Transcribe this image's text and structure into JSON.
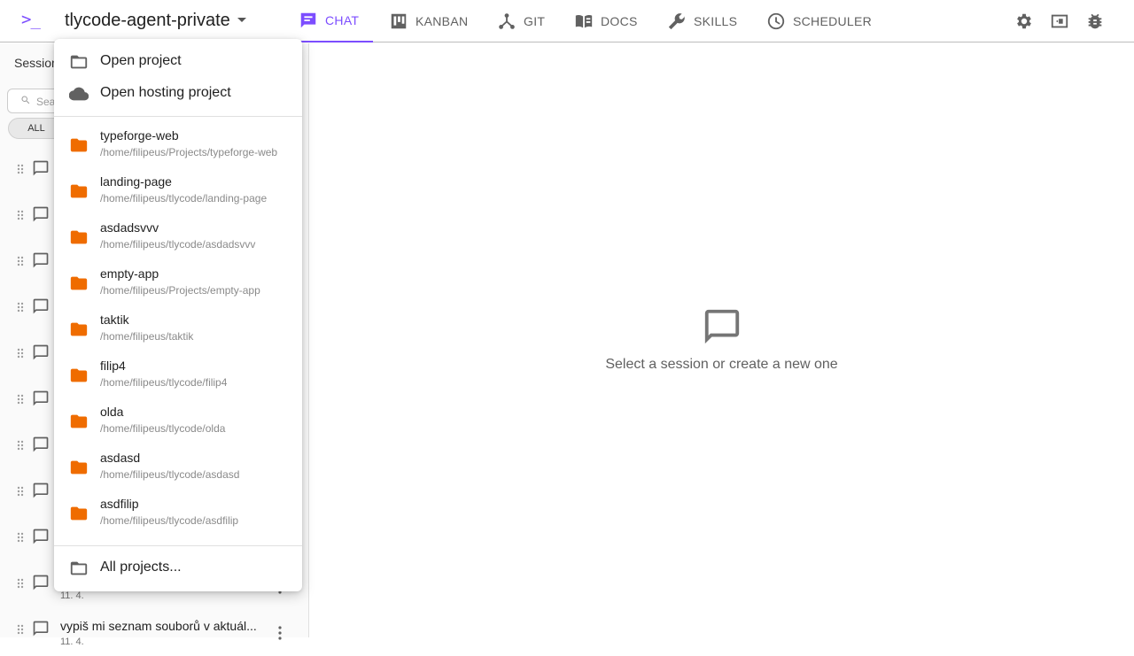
{
  "header": {
    "logo": ">_",
    "project_title": "tlycode-agent-private",
    "tabs": [
      {
        "label": "CHAT",
        "icon": "chat-icon"
      },
      {
        "label": "KANBAN",
        "icon": "kanban-icon"
      },
      {
        "label": "GIT",
        "icon": "git-icon"
      },
      {
        "label": "DOCS",
        "icon": "docs-icon"
      },
      {
        "label": "SKILLS",
        "icon": "wrench-icon"
      },
      {
        "label": "SCHEDULER",
        "icon": "clock-icon"
      }
    ],
    "active_tab": "CHAT",
    "right_icons": [
      "gear-icon",
      "panel-toggle-icon",
      "bug-icon"
    ]
  },
  "sidebar": {
    "title": "Session",
    "search_placeholder": "Sea",
    "filter_chip": "ALL",
    "sessions": [
      {
        "title": "",
        "date": ""
      },
      {
        "title": "",
        "date": ""
      },
      {
        "title": "",
        "date": ""
      },
      {
        "title": "",
        "date": ""
      },
      {
        "title": "",
        "date": ""
      },
      {
        "title": "",
        "date": ""
      },
      {
        "title": "",
        "date": ""
      },
      {
        "title": "",
        "date": ""
      },
      {
        "title": "",
        "date": ""
      },
      {
        "title": "",
        "date": "11. 4."
      },
      {
        "title": "vypiš mi seznam souborů v aktuál...",
        "date": "11. 4."
      }
    ]
  },
  "main": {
    "empty_message": "Select a session or create a new one"
  },
  "project_menu": {
    "actions": [
      {
        "label": "Open project",
        "icon": "folder-outline-icon"
      },
      {
        "label": "Open hosting project",
        "icon": "cloud-icon"
      }
    ],
    "projects": [
      {
        "name": "typeforge-web",
        "path": "/home/filipeus/Projects/typeforge-web"
      },
      {
        "name": "landing-page",
        "path": "/home/filipeus/tlycode/landing-page"
      },
      {
        "name": "asdadsvvv",
        "path": "/home/filipeus/tlycode/asdadsvvv"
      },
      {
        "name": "empty-app",
        "path": "/home/filipeus/Projects/empty-app"
      },
      {
        "name": "taktik",
        "path": "/home/filipeus/taktik"
      },
      {
        "name": "filip4",
        "path": "/home/filipeus/tlycode/filip4"
      },
      {
        "name": "olda",
        "path": "/home/filipeus/tlycode/olda"
      },
      {
        "name": "asdasd",
        "path": "/home/filipeus/tlycode/asdasd"
      },
      {
        "name": "asdfilip",
        "path": "/home/filipeus/tlycode/asdfilip"
      }
    ],
    "all_projects_label": "All projects..."
  },
  "colors": {
    "accent": "#7c4dff",
    "folder": "#ef6c00",
    "icon_gray": "#616161"
  }
}
